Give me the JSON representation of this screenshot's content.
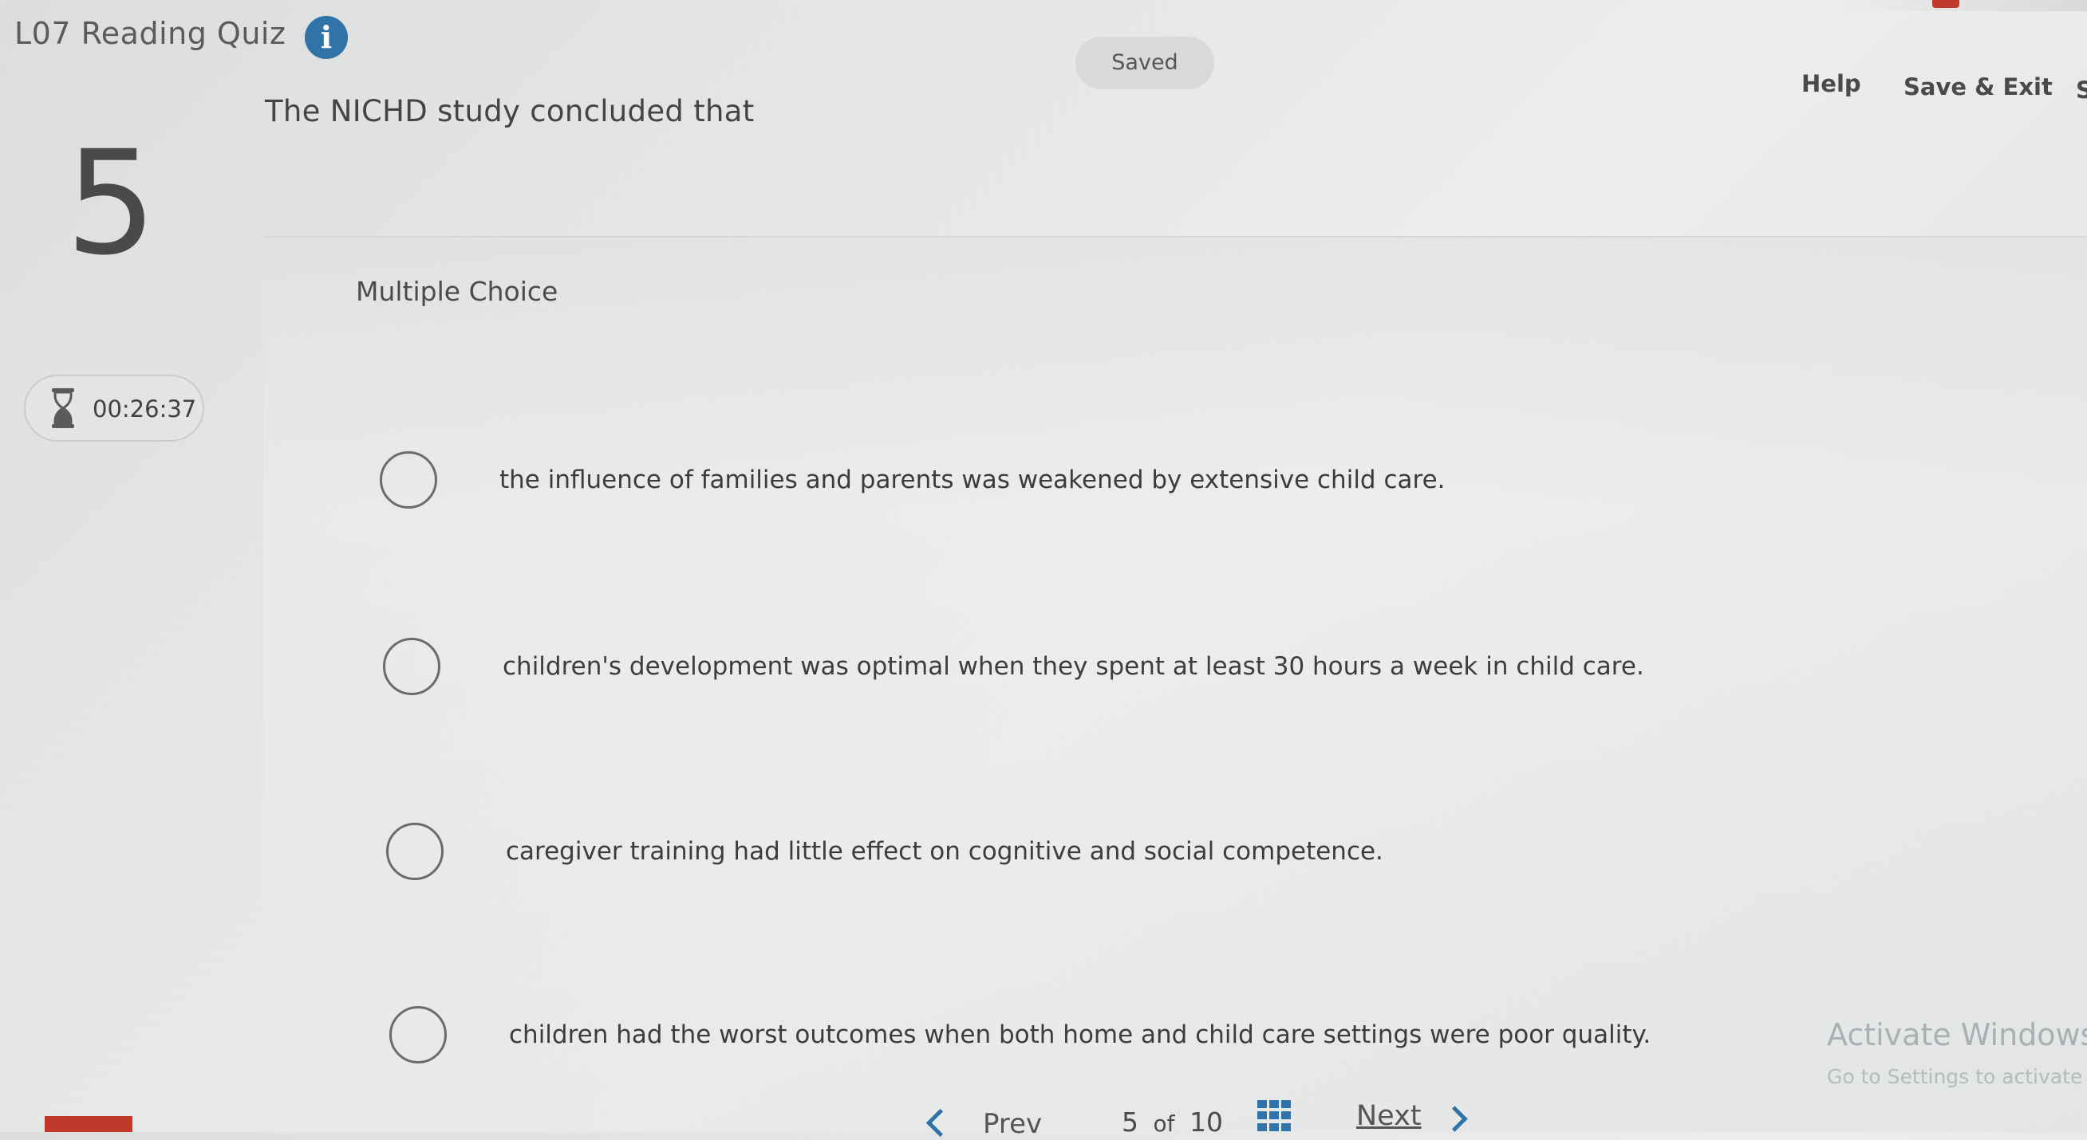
{
  "header": {
    "quiz_title": "L07 Reading Quiz",
    "info_icon_glyph": "i",
    "save_status": "Saved",
    "help_label": "Help",
    "save_exit_label": "Save & Exit",
    "edge_clipped_text": "S"
  },
  "question": {
    "number": "5",
    "prompt": "The NICHD study concluded that",
    "type": "Multiple Choice"
  },
  "timer": {
    "icon": "hourglass-icon",
    "remaining": "00:26:37"
  },
  "options": [
    {
      "label": "the influence of families and parents was weakened by extensive child care.",
      "selected": false
    },
    {
      "label": "children's development was optimal when they spent at least 30 hours a week in child care.",
      "selected": false
    },
    {
      "label": "caregiver training had little effect on cognitive and social competence.",
      "selected": false
    },
    {
      "label": "children had the worst outcomes when both home and child care settings were poor quality.",
      "selected": false
    }
  ],
  "navigation": {
    "prev_label": "Prev",
    "current_page": "5",
    "of_label": "of",
    "total_pages": "10",
    "next_label": "Next",
    "grid_icon": "question-grid-icon"
  },
  "watermark": {
    "title": "Activate Windows",
    "subtitle": "Go to Settings to activate Windows."
  },
  "colors": {
    "accent": "#2f73a8",
    "brand_red": "#c0392b",
    "background": "#e6e8e7"
  }
}
